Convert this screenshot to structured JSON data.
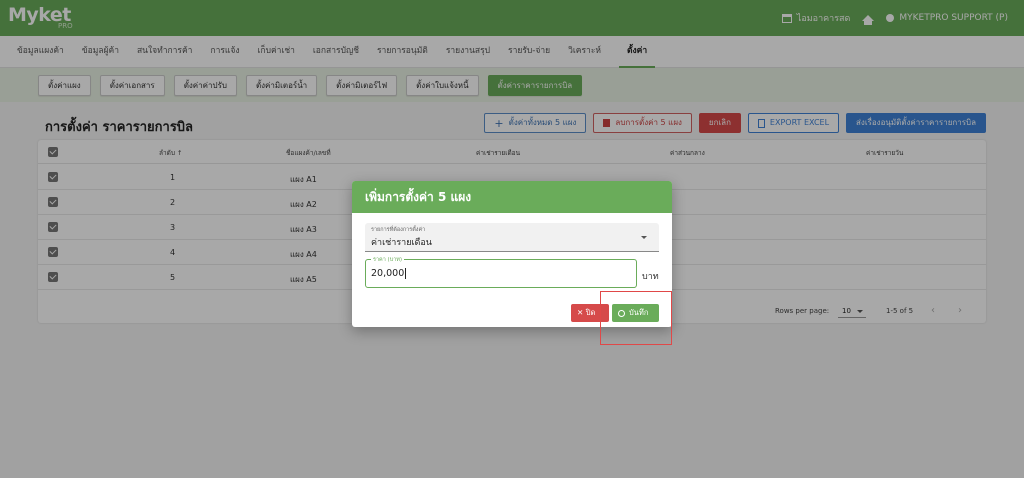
{
  "app": {
    "brand": "Myket",
    "brand_sub": "PRO"
  },
  "topbar": {
    "store": "ไอมอาคารสด",
    "user": "MYKETPRO SUPPORT (P)"
  },
  "main_tabs": [
    "ข้อมูลแผงค้า",
    "ข้อมูลผู้ค้า",
    "สนใจทำการค้า",
    "การแจ้ง",
    "เก็บค่าเช่า",
    "เอกสารบัญชี",
    "รายการอนุมัติ",
    "รายงานสรุป",
    "รายรับ-จ่าย",
    "วิเคราะห์",
    "ตั้งค่า"
  ],
  "sub_tabs": [
    "ตั้งค่าแผง",
    "ตั้งค่าเอกสาร",
    "ตั้งค่าค่าปรับ",
    "ตั้งค่ามิเตอร์น้ำ",
    "ตั้งค่ามิเตอร์ไฟ",
    "ตั้งค่าใบแจ้งหนี้",
    "ตั้งค่าราคารายการบิล"
  ],
  "page": {
    "title": "การตั้งค่า ราคารายการบิล"
  },
  "actions": {
    "add_all": "ตั้งค่าทั้งหมด 5 แผง",
    "delete": "ลบการตั้งค่า 5 แผง",
    "cancel": "ยกเลิก",
    "export": "EXPORT EXCEL",
    "send": "ส่งเรื่องอนุมัติตั้งค่าราคารายการบิล"
  },
  "table": {
    "headers": [
      "ลำดับ",
      "ชื่อแผงค้า/เลขที่",
      "ค่าเช่ารายเดือน",
      "ค่าส่วนกลาง",
      "ค่าเช่ารายวัน"
    ],
    "rows": [
      {
        "no": "1",
        "name": "แผง A1"
      },
      {
        "no": "2",
        "name": "แผง A2"
      },
      {
        "no": "3",
        "name": "แผง A3"
      },
      {
        "no": "4",
        "name": "แผง A4"
      },
      {
        "no": "5",
        "name": "แผง A5"
      }
    ],
    "rows_per_page_label": "Rows per page:",
    "rows_per_page": "10",
    "range": "1-5 of 5"
  },
  "dialog": {
    "title": "เพิ่มการตั้งค่า 5 แผง",
    "select_label": "รายการที่ต้องการตั้งค่า",
    "select_value": "ค่าเช่ารายเดือน",
    "price_label": "ราคา (บาท)",
    "price_value": "20,000",
    "unit": "บาท",
    "close_label": "ปิด",
    "save_label": "บันทึก"
  },
  "colors": {
    "brand": "#6aac5a",
    "danger": "#d64a4a",
    "primary": "#3f82d6"
  }
}
